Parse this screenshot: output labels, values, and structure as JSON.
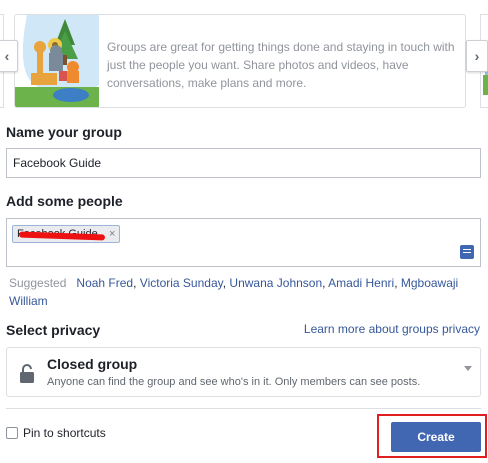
{
  "carousel": {
    "description": "Groups are great for getting things done and staying in touch with just the people you want. Share photos and videos, have conversations, make plans and more.",
    "prev_icon": "chevron-left-icon",
    "next_icon": "chevron-right-icon",
    "prev_glyph": "‹",
    "next_glyph": "›"
  },
  "name_section": {
    "label": "Name your group",
    "value": "Facebook Guide"
  },
  "people_section": {
    "label": "Add some people",
    "token_text": "Facebook Guide",
    "token_remove": "×",
    "compose_icon": "compose-icon"
  },
  "suggested": {
    "label": "Suggested",
    "people": [
      "Noah Fred",
      "Victoria Sunday",
      "Unwana Johnson",
      "Amadi Henri",
      "Mgboawaji William"
    ]
  },
  "privacy": {
    "label": "Select privacy",
    "learn_more": "Learn more about groups privacy",
    "option_title": "Closed group",
    "option_description": "Anyone can find the group and see who's in it. Only members can see posts.",
    "option_icon": "lock-icon"
  },
  "footer": {
    "pin_label": "Pin to shortcuts",
    "create_label": "Create"
  },
  "colors": {
    "accent": "#4267b2",
    "link": "#365899",
    "highlight": "#e02020"
  }
}
